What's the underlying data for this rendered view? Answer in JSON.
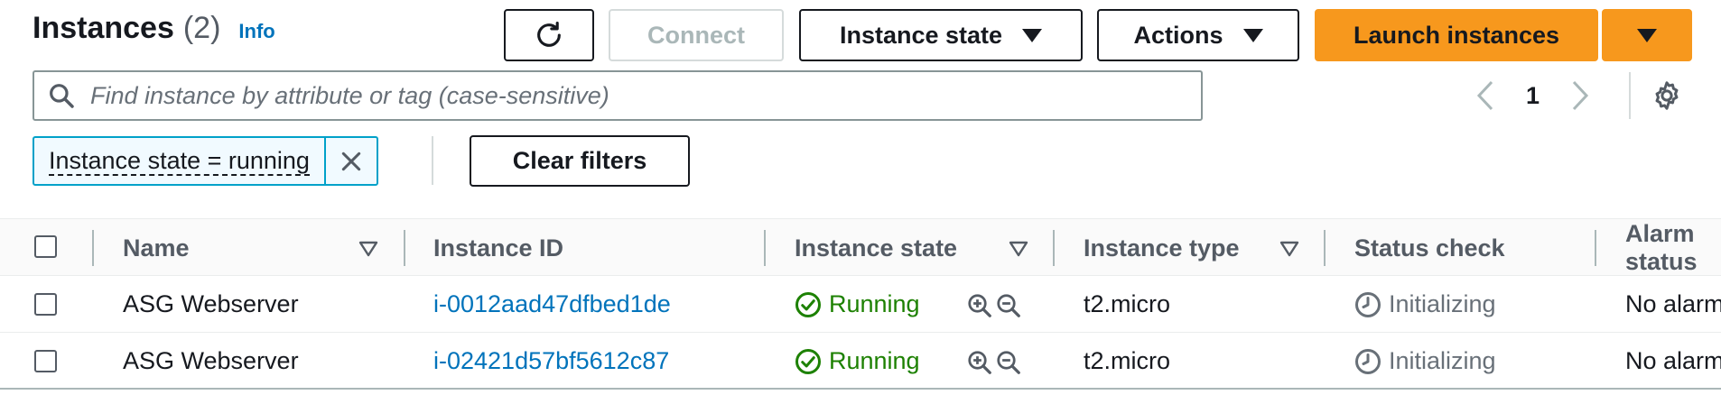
{
  "header": {
    "title": "Instances",
    "count": "(2)",
    "info_link": "Info"
  },
  "toolbar": {
    "refresh_icon": "refresh-icon",
    "connect_label": "Connect",
    "instance_state_label": "Instance state",
    "actions_label": "Actions",
    "launch_label": "Launch instances"
  },
  "search": {
    "placeholder": "Find instance by attribute or tag (case-sensitive)",
    "value": ""
  },
  "pagination": {
    "current_page": "1"
  },
  "filters": {
    "token_label": "Instance state = running",
    "clear_label": "Clear filters"
  },
  "table": {
    "columns": [
      "Name",
      "Instance ID",
      "Instance state",
      "Instance type",
      "Status check",
      "Alarm status"
    ],
    "rows": [
      {
        "name": "ASG Webserver",
        "instance_id": "i-0012aad47dfbed1de",
        "state": "Running",
        "type": "t2.micro",
        "status_check": "Initializing",
        "alarm": "No alarms"
      },
      {
        "name": "ASG Webserver",
        "instance_id": "i-02421d57bf5612c87",
        "state": "Running",
        "type": "t2.micro",
        "status_check": "Initializing",
        "alarm": "No alarms"
      }
    ]
  },
  "colors": {
    "primary": "#f7981d",
    "link": "#0073bb",
    "running": "#1d8102",
    "token_border": "#00a1c9"
  }
}
